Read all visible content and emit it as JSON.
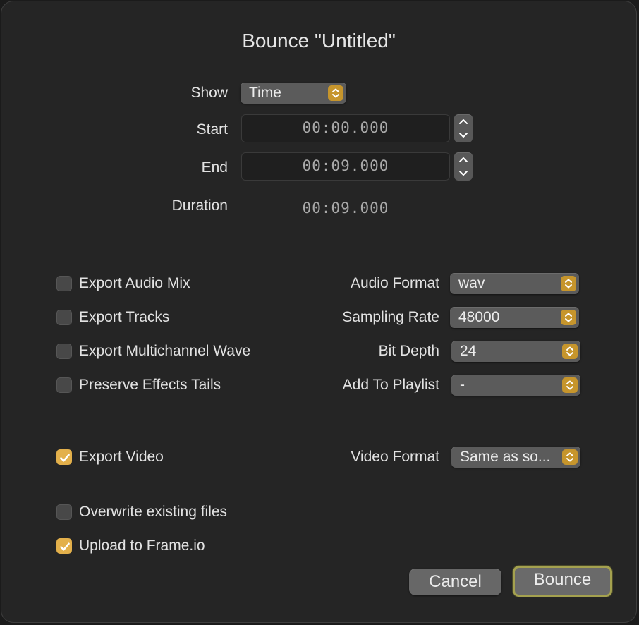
{
  "dialog": {
    "title": "Bounce \"Untitled\""
  },
  "range": {
    "show_label": "Show",
    "show_value": "Time",
    "start_label": "Start",
    "start_value": "00:00.000",
    "end_label": "End",
    "end_value": "00:09.000",
    "duration_label": "Duration",
    "duration_value": "00:09.000"
  },
  "options": {
    "export_audio_mix": {
      "label": "Export Audio Mix",
      "checked": false
    },
    "export_tracks": {
      "label": "Export Tracks",
      "checked": false
    },
    "export_multichannel_wave": {
      "label": "Export Multichannel Wave",
      "checked": false
    },
    "preserve_effects_tails": {
      "label": "Preserve Effects Tails",
      "checked": false
    },
    "export_video": {
      "label": "Export Video",
      "checked": true
    },
    "overwrite_existing_files": {
      "label": "Overwrite existing files",
      "checked": false
    },
    "upload_to_frameio": {
      "label": "Upload to Frame.io",
      "checked": true
    }
  },
  "formats": {
    "audio_format_label": "Audio Format",
    "audio_format_value": "wav",
    "sampling_rate_label": "Sampling Rate",
    "sampling_rate_value": "48000",
    "bit_depth_label": "Bit Depth",
    "bit_depth_value": "24",
    "add_to_playlist_label": "Add To Playlist",
    "add_to_playlist_value": "-",
    "video_format_label": "Video Format",
    "video_format_value": "Same as so..."
  },
  "buttons": {
    "cancel_label": "Cancel",
    "bounce_label": "Bounce"
  },
  "colors": {
    "accent": "#e3b04b",
    "popup_arrow": "#c6952c",
    "default_button_ring": "#a4a14f"
  }
}
